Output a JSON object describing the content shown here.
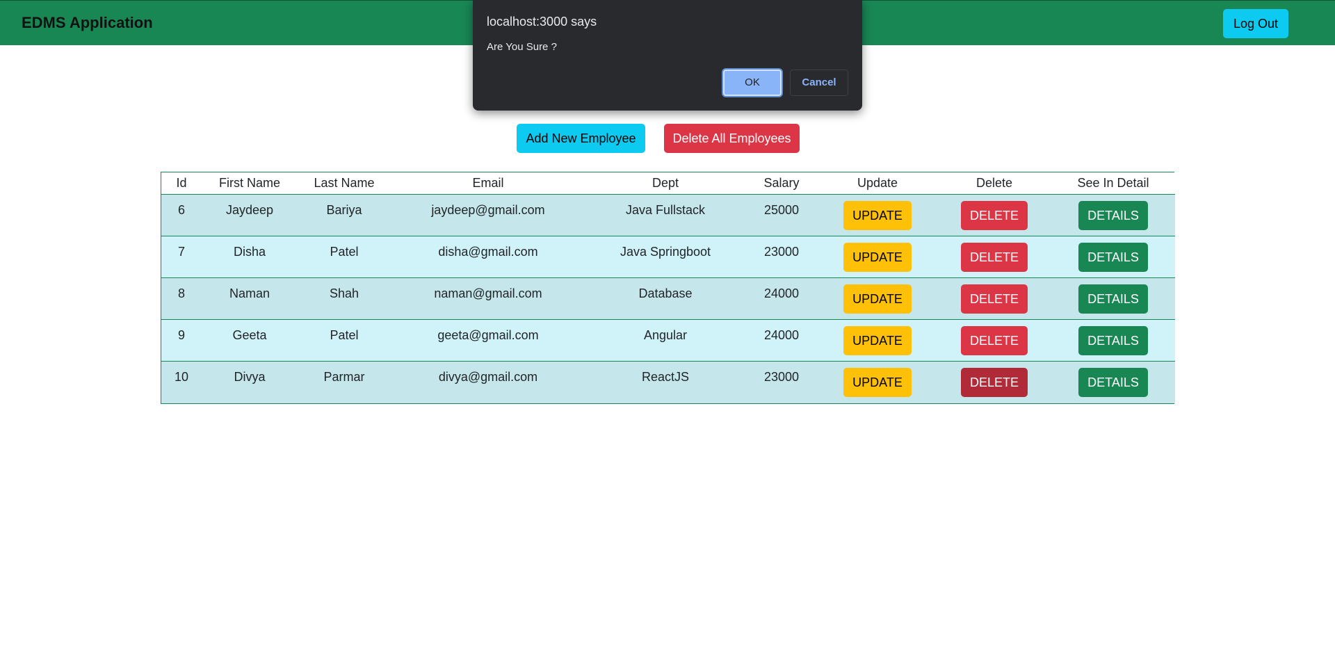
{
  "navbar": {
    "brand": "EDMS Application",
    "logout_label": "Log Out"
  },
  "actions": {
    "add_label": "Add New Employee",
    "delete_all_label": "Delete All Employees"
  },
  "table": {
    "headers": [
      "Id",
      "First Name",
      "Last Name",
      "Email",
      "Dept",
      "Salary",
      "Update",
      "Delete",
      "See In Detail"
    ],
    "rows": [
      {
        "id": "6",
        "first": "Jaydeep",
        "last": "Bariya",
        "email": "jaydeep@gmail.com",
        "dept": "Java Fullstack",
        "salary": "25000"
      },
      {
        "id": "7",
        "first": "Disha",
        "last": "Patel",
        "email": "disha@gmail.com",
        "dept": "Java Springboot",
        "salary": "23000"
      },
      {
        "id": "8",
        "first": "Naman",
        "last": "Shah",
        "email": "naman@gmail.com",
        "dept": "Database",
        "salary": "24000"
      },
      {
        "id": "9",
        "first": "Geeta",
        "last": "Patel",
        "email": "geeta@gmail.com",
        "dept": "Angular",
        "salary": "24000"
      },
      {
        "id": "10",
        "first": "Divya",
        "last": "Parmar",
        "email": "divya@gmail.com",
        "dept": "ReactJS",
        "salary": "23000"
      }
    ],
    "update_label": "UPDATE",
    "delete_label": "DELETE",
    "details_label": "DETAILS"
  },
  "dialog": {
    "title": "localhost:3000 says",
    "message": "Are You Sure ?",
    "ok_label": "OK",
    "cancel_label": "Cancel"
  },
  "colors": {
    "navbar": "#198754",
    "info": "#0dcaf0",
    "danger": "#dc3545",
    "warning": "#ffc107",
    "success": "#198754",
    "dialog_bg": "#292a2d",
    "dialog_accent": "#8ab4f8"
  }
}
